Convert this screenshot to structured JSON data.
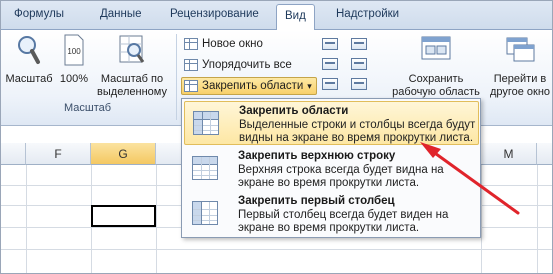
{
  "tabs": [
    "Формулы",
    "Данные",
    "Рецензирование",
    "Вид",
    "Надстройки"
  ],
  "ribbon": {
    "zoom_group": {
      "zoom_label": "Масштаб",
      "hundred_label": "100%",
      "zoom_to_selection_line1": "Масштаб по",
      "zoom_to_selection_line2": "выделенному",
      "group_label": "Масштаб"
    },
    "window_group": {
      "new_window": "Новое окно",
      "arrange_all": "Упорядочить все",
      "freeze_panes": "Закрепить области",
      "dropdown_arrow": "▾",
      "save_workspace_line1": "Сохранить",
      "save_workspace_line2": "рабочую область",
      "switch_windows_line1": "Перейти в",
      "switch_windows_line2": "другое окно"
    }
  },
  "sheet": {
    "columns": [
      "F",
      "G",
      "M"
    ],
    "selected_column": "G"
  },
  "freeze_menu": {
    "items": [
      {
        "title": "Закрепить области",
        "description": "Выделенные строки и столбцы всегда будут видны на экране во время прокрутки листа."
      },
      {
        "title": "Закрепить верхнюю строку",
        "description": "Верхняя строка всегда будет видна на экране во время прокрутки листа."
      },
      {
        "title": "Закрепить первый столбец",
        "description": "Первый столбец всегда будет виден на экране во время прокрутки листа."
      }
    ]
  },
  "colors": {
    "accent_red": "#e0242b",
    "highlight": "#fde7a4",
    "selected_header": "#f4c862"
  }
}
